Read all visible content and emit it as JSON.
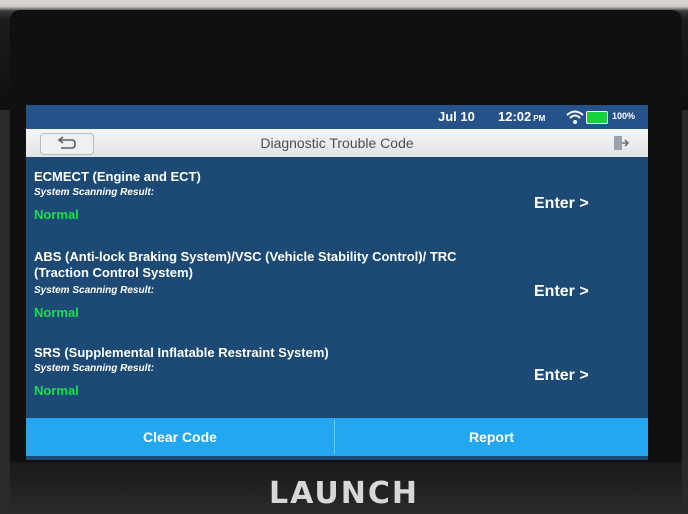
{
  "status_bar": {
    "date": "Jul 10",
    "time": "12:02",
    "ampm": "PM",
    "battery": "100%",
    "battery_color": "#19d23b"
  },
  "header": {
    "title": "Diagnostic Trouble Code",
    "back_icon": "back-arrow-icon",
    "exit_icon": "exit-door-icon"
  },
  "systems": [
    {
      "name": "ECMECT (Engine and ECT)",
      "scan_label": "System Scanning Result:",
      "result": "Normal",
      "action": "Enter >"
    },
    {
      "name": "ABS (Anti-lock Braking System)/VSC (Vehicle Stability Control)/ TRC (Traction Control System)",
      "scan_label": "System Scanning Result:",
      "result": "Normal",
      "action": "Enter >"
    },
    {
      "name": "SRS (Supplemental Inflatable Restraint System)",
      "scan_label": "System Scanning Result:",
      "result": "Normal",
      "action": "Enter >"
    }
  ],
  "footer": {
    "clear_code": "Clear Code",
    "report": "Report"
  },
  "device": {
    "brand": "LAUNCH"
  },
  "colors": {
    "screen_bg": "#1d4a74",
    "result_normal": "#16e04a",
    "action_bar": "#23a8ef"
  }
}
